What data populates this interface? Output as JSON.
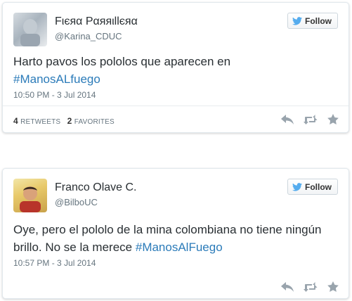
{
  "colors": {
    "link": "#2b7bb9",
    "follow_bird": "#55acee",
    "action_icon": "#99a4ad"
  },
  "follow_label": "Follow",
  "tweets": [
    {
      "display_name": "Fιєяα Pαяяιllєяα",
      "handle": "@Karina_CDUC",
      "text_before": "Harto pavos los pololos que aparecen en",
      "hashtag": "#ManosALfuego",
      "timestamp": "10:50 PM - 3 Jul 2014",
      "retweets": "4",
      "retweets_label": "Retweets",
      "favorites": "2",
      "favorites_label": "Favorites",
      "icons": [
        "reply-icon",
        "retweet-icon",
        "favorite-star-icon"
      ]
    },
    {
      "display_name": "Franco Olave C.",
      "handle": "@BilboUC",
      "text_before": "Oye, pero el pololo de la mina colombiana no tiene ningún brillo. No se la merece",
      "hashtag": "#ManosAlFuego",
      "timestamp": "10:57 PM - 3 Jul 2014",
      "icons": [
        "reply-icon",
        "retweet-icon",
        "favorite-star-icon"
      ]
    }
  ]
}
